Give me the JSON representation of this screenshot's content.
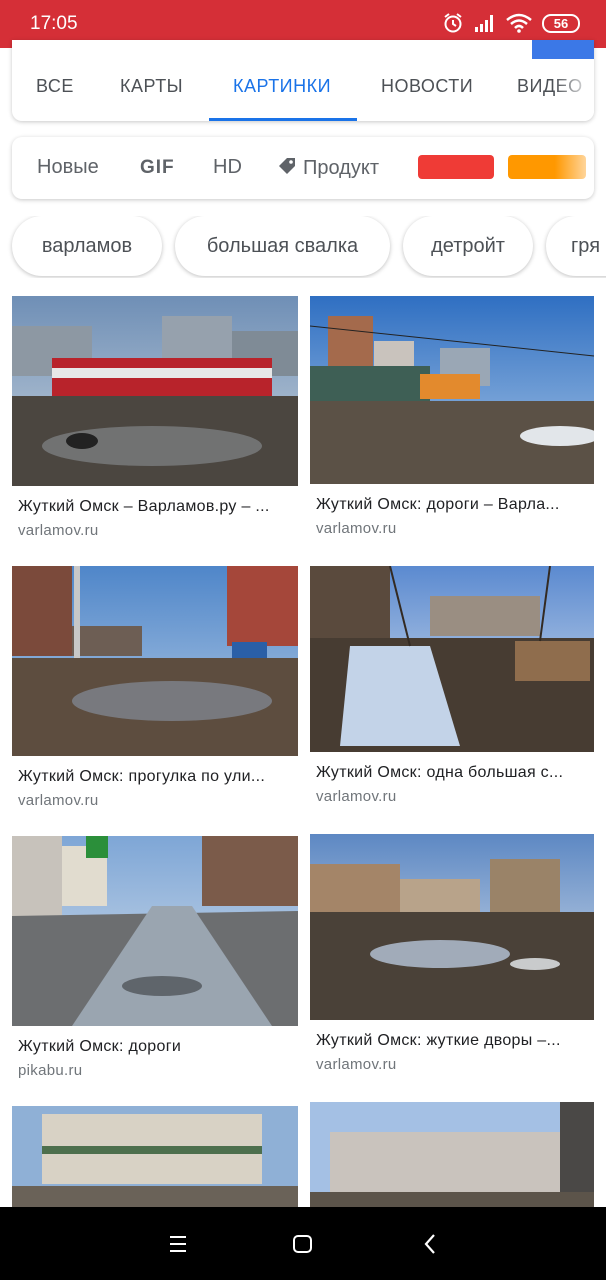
{
  "status": {
    "time": "17:05",
    "battery": "56"
  },
  "tabs": [
    {
      "label": "ВСЕ",
      "active": false
    },
    {
      "label": "КАРТЫ",
      "active": false
    },
    {
      "label": "КАРТИНКИ",
      "active": true
    },
    {
      "label": "НОВОСТИ",
      "active": false
    },
    {
      "label": "ВИДЕО",
      "active": false
    }
  ],
  "filters": {
    "new": "Новые",
    "gif": "GIF",
    "hd": "HD",
    "product": "Продукт"
  },
  "colors": {
    "brand_red": "#d52f37",
    "accent_blue": "#1a73e8",
    "swatch_red": "#ef3b36",
    "swatch_orange": "#ff9800"
  },
  "chips": [
    "варламов",
    "большая свалка",
    "детройт",
    "гря"
  ],
  "results": [
    {
      "title": "Жуткий Омск – Варламов.ру – ...",
      "source": "varlamov.ru"
    },
    {
      "title": "Жуткий Омск: дороги – Варла...",
      "source": "varlamov.ru"
    },
    {
      "title": "Жуткий Омск: прогулка по ули...",
      "source": "varlamov.ru"
    },
    {
      "title": "Жуткий Омск: одна большая с...",
      "source": "varlamov.ru"
    },
    {
      "title": "Жуткий Омск: дороги",
      "source": "pikabu.ru"
    },
    {
      "title": "Жуткий Омск: жуткие дворы –...",
      "source": "varlamov.ru"
    }
  ]
}
